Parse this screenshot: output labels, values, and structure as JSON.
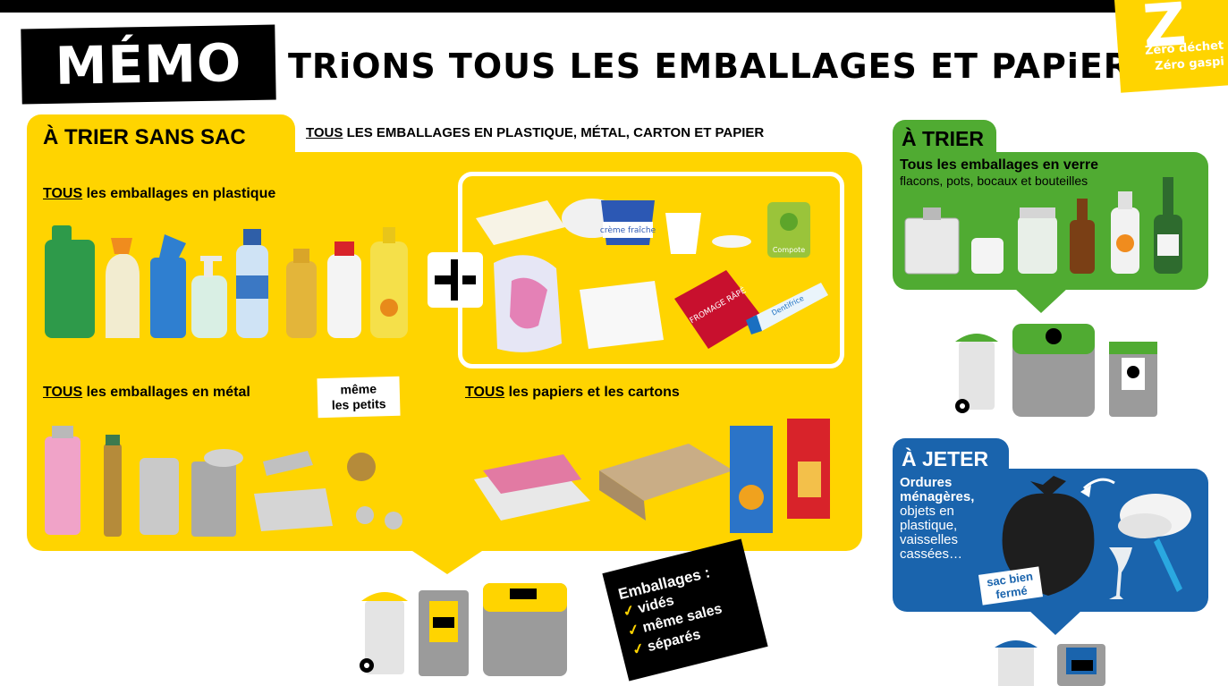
{
  "header": {
    "memo_title": "MÉMO TRi",
    "headline": "TRiONS TOUS LES EMBALLAGES ET PAPiERS !",
    "logo_letter": "Z",
    "logo_line1": "Zéro déchet",
    "logo_line2": "Zéro gaspi"
  },
  "sort_zone": {
    "title": "À TRIER SANS SAC",
    "subtitle_keyword": "TOUS",
    "subtitle_rest": " LES EMBALLAGES EN PLASTIQUE, MÉTAL, CARTON ET PAPIER",
    "plastic": {
      "keyword": "TOUS",
      "rest": " les emballages en plastique"
    },
    "metal": {
      "keyword": "TOUS",
      "rest": " les emballages en métal"
    },
    "small_badge_line1": "même",
    "small_badge_line2": "les petits",
    "paper": {
      "keyword": "TOUS",
      "rest": " les papiers et les cartons"
    },
    "label_creme": "crème fraîche",
    "label_compote": "Compote",
    "label_fromage": "FROMAGE RÂPÉ",
    "label_dentifrice": "Dentifrice"
  },
  "glass_zone": {
    "title": "À TRIER",
    "subtitle": "Tous les emballages en verre",
    "subtitle2": "flacons, pots, bocaux et bouteilles"
  },
  "waste_zone": {
    "title": "À JETER",
    "bold_text": "Ordures ménagères,",
    "text": "objets en plastique, vaisselles cassées…",
    "bag_badge_line1": "sac bien",
    "bag_badge_line2": "fermé"
  },
  "note": {
    "title": "Emballages :",
    "items": [
      "vidés",
      "même sales",
      "séparés"
    ],
    "check": "✓"
  },
  "colors": {
    "yellow": "#ffd400",
    "green": "#50ab32",
    "blue": "#1a64ad",
    "black": "#000000",
    "bin_grey": "#9b9b9b"
  }
}
